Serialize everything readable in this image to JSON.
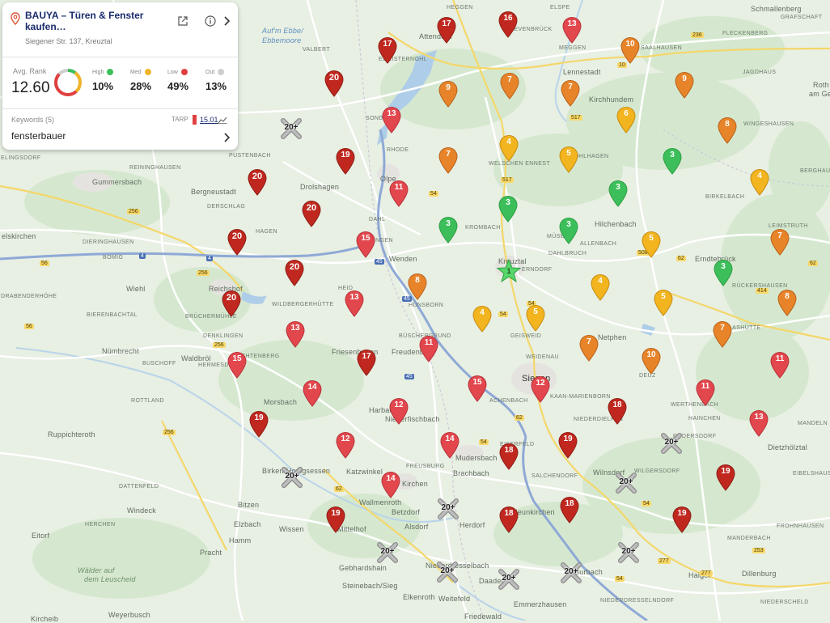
{
  "card": {
    "business_name": "BAUYA – Türen & Fenster kaufen…",
    "address": "Siegener Str. 137, Kreuztal",
    "avg_rank_label": "Avg. Rank",
    "avg_rank": "12.60",
    "stats": [
      {
        "label": "High",
        "value": "10%",
        "color": "#3cbf5a"
      },
      {
        "label": "Med",
        "value": "28%",
        "color": "#f0b429"
      },
      {
        "label": "Low",
        "value": "49%",
        "color": "#e04040"
      },
      {
        "label": "Out",
        "value": "13%",
        "color": "#cfcfcf"
      }
    ],
    "keywords_label": "Keywords (5)",
    "tarp_label": "TARP",
    "tarp_value": "15.01",
    "keyword": "fensterbauer"
  },
  "colors": {
    "green": "#3cbf5a",
    "yellow": "#f2b41f",
    "orange": "#e7842a",
    "red": "#e2474d",
    "darkred": "#c0281f"
  },
  "not_ranked_label": "20+",
  "center_rank": "1",
  "places": [
    {
      "t": "HEGGEN",
      "k": "caps"
    },
    {
      "t": "ELSPE",
      "k": "caps"
    },
    {
      "t": "Schmallenberg",
      "k": ""
    },
    {
      "t": "GRAFSCHAFT",
      "k": "caps"
    },
    {
      "t": "Auf'm Ebbe/",
      "k": "water"
    },
    {
      "t": "Ebbemoore",
      "k": "water"
    },
    {
      "t": "Attendorn",
      "k": ""
    },
    {
      "t": "REVENBRÜCK",
      "k": "caps"
    },
    {
      "t": "VALBERT",
      "k": "caps"
    },
    {
      "t": "EL-LISTERNOHL",
      "k": "caps"
    },
    {
      "t": "MEGGEN",
      "k": "caps"
    },
    {
      "t": "SAALHAUSEN",
      "k": "caps"
    },
    {
      "t": "FLECKENBERG",
      "k": "caps"
    },
    {
      "t": "Lennestadt",
      "k": ""
    },
    {
      "t": "Kirchhundem",
      "k": ""
    },
    {
      "t": "JAGDHAUS",
      "k": "caps"
    },
    {
      "t": "Roth",
      "k": ""
    },
    {
      "t": "am Ge",
      "k": ""
    },
    {
      "t": "SONDERN",
      "k": "caps"
    },
    {
      "t": "WINGESHAUSEN",
      "k": "caps"
    },
    {
      "t": "PUSTENBACH",
      "k": "caps"
    },
    {
      "t": "RHODE",
      "k": "caps"
    },
    {
      "t": "WELSCHEN ENNEST",
      "k": "caps"
    },
    {
      "t": "OHLHAGEN",
      "k": "caps"
    },
    {
      "t": "ELINGSDORF",
      "k": "caps"
    },
    {
      "t": "REININGHAUSEN",
      "k": "caps"
    },
    {
      "t": "Gummersbach",
      "k": ""
    },
    {
      "t": "Bergneustadt",
      "k": ""
    },
    {
      "t": "Drolshagen",
      "k": ""
    },
    {
      "t": "Olpe",
      "k": ""
    },
    {
      "t": "BERGHAUSEN",
      "k": "caps"
    },
    {
      "t": "BIRKELBACH",
      "k": "caps"
    },
    {
      "t": "DERSCHLAG",
      "k": "caps"
    },
    {
      "t": "DAHL",
      "k": "caps"
    },
    {
      "t": "Hilchenbach",
      "k": ""
    },
    {
      "t": "Erndtebrück",
      "k": ""
    },
    {
      "t": "elskirchen",
      "k": ""
    },
    {
      "t": "DIERINGHAUSEN",
      "k": "caps"
    },
    {
      "t": "HAGEN",
      "k": "caps"
    },
    {
      "t": "KROMBACH",
      "k": "caps"
    },
    {
      "t": "MÜSEN",
      "k": "caps"
    },
    {
      "t": "ALLENBACH",
      "k": "caps"
    },
    {
      "t": "LEIMSTRUTH",
      "k": "caps"
    },
    {
      "t": "BOMIG",
      "k": "caps"
    },
    {
      "t": "RLINGEN",
      "k": "caps"
    },
    {
      "t": "Wenden",
      "k": ""
    },
    {
      "t": "DAHLBRUCH",
      "k": "caps"
    },
    {
      "t": "Kreuztal",
      "k": ""
    },
    {
      "t": "ERNDORF",
      "k": "caps"
    },
    {
      "t": "Wiehl",
      "k": ""
    },
    {
      "t": "Reichshof",
      "k": ""
    },
    {
      "t": "DRABENDERHÖHE",
      "k": "caps"
    },
    {
      "t": "HEID",
      "k": "caps"
    },
    {
      "t": "HÜNSBORN",
      "k": "caps"
    },
    {
      "t": "RÜCKERSHAUSEN",
      "k": "caps"
    },
    {
      "t": "BIERENBACHTAL",
      "k": "caps"
    },
    {
      "t": "BRÜCHERMÜHLE",
      "k": "caps"
    },
    {
      "t": "WILDBERGERHÜTTE",
      "k": "caps"
    },
    {
      "t": "GLASHÜTTE",
      "k": "caps"
    },
    {
      "t": "DENKLINGEN",
      "k": "caps"
    },
    {
      "t": "BÜSCHERGRUND",
      "k": "caps"
    },
    {
      "t": "GEISWEID",
      "k": "caps"
    },
    {
      "t": "Netphen",
      "k": ""
    },
    {
      "t": "Nümbrecht",
      "k": ""
    },
    {
      "t": "ECHTENBERG",
      "k": "caps"
    },
    {
      "t": "Friesenhagen",
      "k": ""
    },
    {
      "t": "Freudenberg",
      "k": ""
    },
    {
      "t": "WEIDENAU",
      "k": "caps"
    },
    {
      "t": "BUSCHOFF",
      "k": "caps"
    },
    {
      "t": "HERMESDORF",
      "k": "caps"
    },
    {
      "t": "Waldbröl",
      "k": ""
    },
    {
      "t": "Siegen",
      "k": "city"
    },
    {
      "t": "DEUZ",
      "k": "caps"
    },
    {
      "t": "ACHENBACH",
      "k": "caps"
    },
    {
      "t": "KAAN-MARIENBORN",
      "k": "caps"
    },
    {
      "t": "WERTHENBACH",
      "k": "caps"
    },
    {
      "t": "Morsbach",
      "k": ""
    },
    {
      "t": "Harbach",
      "k": ""
    },
    {
      "t": "ROTTLAND",
      "k": "caps"
    },
    {
      "t": "Niederfischbach",
      "k": ""
    },
    {
      "t": "NIEDERDIELFEN",
      "k": "caps"
    },
    {
      "t": "HAINCHEN",
      "k": "caps"
    },
    {
      "t": "MANDELN",
      "k": "caps"
    },
    {
      "t": "Ruppichteroth",
      "k": ""
    },
    {
      "t": "RUDERSDORF",
      "k": "caps"
    },
    {
      "t": "Dietzhölztal",
      "k": ""
    },
    {
      "t": "EISERFELD",
      "k": "caps"
    },
    {
      "t": "Mudersbach",
      "k": ""
    },
    {
      "t": "Birken-Honigsessen",
      "k": ""
    },
    {
      "t": "Katzwinkel",
      "k": ""
    },
    {
      "t": "FREUSBURG",
      "k": "caps"
    },
    {
      "t": "Brachbach",
      "k": ""
    },
    {
      "t": "Wilnsdorf",
      "k": ""
    },
    {
      "t": "WILGERSDORF",
      "k": "caps"
    },
    {
      "t": "EIBELSHAUSEN",
      "k": "caps"
    },
    {
      "t": "DATTENFELD",
      "k": "caps"
    },
    {
      "t": "Kirchen",
      "k": ""
    },
    {
      "t": "SALCHENDORF",
      "k": "caps"
    },
    {
      "t": "Wallmenroth",
      "k": ""
    },
    {
      "t": "Windeck",
      "k": ""
    },
    {
      "t": "Betzdorf",
      "k": ""
    },
    {
      "t": "Neunkirchen",
      "k": ""
    },
    {
      "t": "Bitzen",
      "k": ""
    },
    {
      "t": "Elzbach",
      "k": ""
    },
    {
      "t": "Wissen",
      "k": ""
    },
    {
      "t": "Mittelhof",
      "k": ""
    },
    {
      "t": "Alsdorf",
      "k": ""
    },
    {
      "t": "Herdorf",
      "k": ""
    },
    {
      "t": "FROHNHAUSEN",
      "k": "caps"
    },
    {
      "t": "Eitorf",
      "k": ""
    },
    {
      "t": "HERCHEN",
      "k": "caps"
    },
    {
      "t": "Hamm",
      "k": ""
    },
    {
      "t": "MANDERBACH",
      "k": "caps"
    },
    {
      "t": "Pracht",
      "k": ""
    },
    {
      "t": "Gebhardshain",
      "k": ""
    },
    {
      "t": "Niederdresselbach",
      "k": ""
    },
    {
      "t": "Burbach",
      "k": ""
    },
    {
      "t": "Haiger",
      "k": ""
    },
    {
      "t": "Dillenburg",
      "k": ""
    },
    {
      "t": "Wälder auf",
      "k": "forest"
    },
    {
      "t": "dem Leuscheid",
      "k": "forest"
    },
    {
      "t": "Steinebach/Sieg",
      "k": ""
    },
    {
      "t": "Elkenroth",
      "k": ""
    },
    {
      "t": "Daaden",
      "k": ""
    },
    {
      "t": "Emmerzhausen",
      "k": ""
    },
    {
      "t": "NIEDERDRESSELNDORF",
      "k": "caps"
    },
    {
      "t": "NIEDERSCHELD",
      "k": "caps"
    },
    {
      "t": "Weyerbusch",
      "k": ""
    },
    {
      "t": "Weitefeld",
      "k": ""
    },
    {
      "t": "Friedewald",
      "k": ""
    },
    {
      "t": "Kircheib",
      "k": ""
    }
  ],
  "roads": [
    "236",
    "10",
    "517",
    "517",
    "54",
    "54",
    "508",
    "62",
    "62",
    "256",
    "256",
    "256",
    "4",
    "4",
    "45",
    "45",
    "45",
    "56",
    "56",
    "54",
    "256",
    "54",
    "62",
    "54",
    "277",
    "277",
    "253",
    "54",
    "62",
    "414"
  ],
  "pins": [
    {
      "r": "17"
    },
    {
      "r": "16"
    },
    {
      "r": "13"
    },
    {
      "r": "17"
    },
    {
      "r": "10"
    },
    {
      "r": "20"
    },
    {
      "r": "9"
    },
    {
      "r": "7"
    },
    {
      "r": "7"
    },
    {
      "r": "9"
    },
    {
      "r": "13"
    },
    {
      "r": "6"
    },
    {
      "r": "8"
    },
    {
      "r": "19"
    },
    {
      "r": "4"
    },
    {
      "r": "7"
    },
    {
      "r": "5"
    },
    {
      "r": "3"
    },
    {
      "r": "4"
    },
    {
      "r": "20"
    },
    {
      "r": "11"
    },
    {
      "r": "3"
    },
    {
      "r": "3"
    },
    {
      "r": "20"
    },
    {
      "r": "3"
    },
    {
      "r": "3"
    },
    {
      "r": "20"
    },
    {
      "r": "15"
    },
    {
      "r": "5"
    },
    {
      "r": "7"
    },
    {
      "r": "20"
    },
    {
      "r": "3"
    },
    {
      "r": "8"
    },
    {
      "r": "4"
    },
    {
      "r": "20"
    },
    {
      "r": "13"
    },
    {
      "r": "5"
    },
    {
      "r": "8"
    },
    {
      "r": "4"
    },
    {
      "r": "5"
    },
    {
      "r": "13"
    },
    {
      "r": "7"
    },
    {
      "r": "11"
    },
    {
      "r": "7"
    },
    {
      "r": "15"
    },
    {
      "r": "17"
    },
    {
      "r": "10"
    },
    {
      "r": "11"
    },
    {
      "r": "15"
    },
    {
      "r": "12"
    },
    {
      "r": "11"
    },
    {
      "r": "14"
    },
    {
      "r": "12"
    },
    {
      "r": "18"
    },
    {
      "r": "19"
    },
    {
      "r": "13"
    },
    {
      "r": "12"
    },
    {
      "r": "14"
    },
    {
      "r": "19"
    },
    {
      "r": "18"
    },
    {
      "r": "19"
    },
    {
      "r": "14"
    },
    {
      "r": "19"
    },
    {
      "r": "18"
    },
    {
      "r": "18"
    },
    {
      "r": "19"
    }
  ],
  "crosses": [
    {},
    {},
    {},
    {},
    {},
    {},
    {},
    {},
    {},
    {},
    {}
  ]
}
